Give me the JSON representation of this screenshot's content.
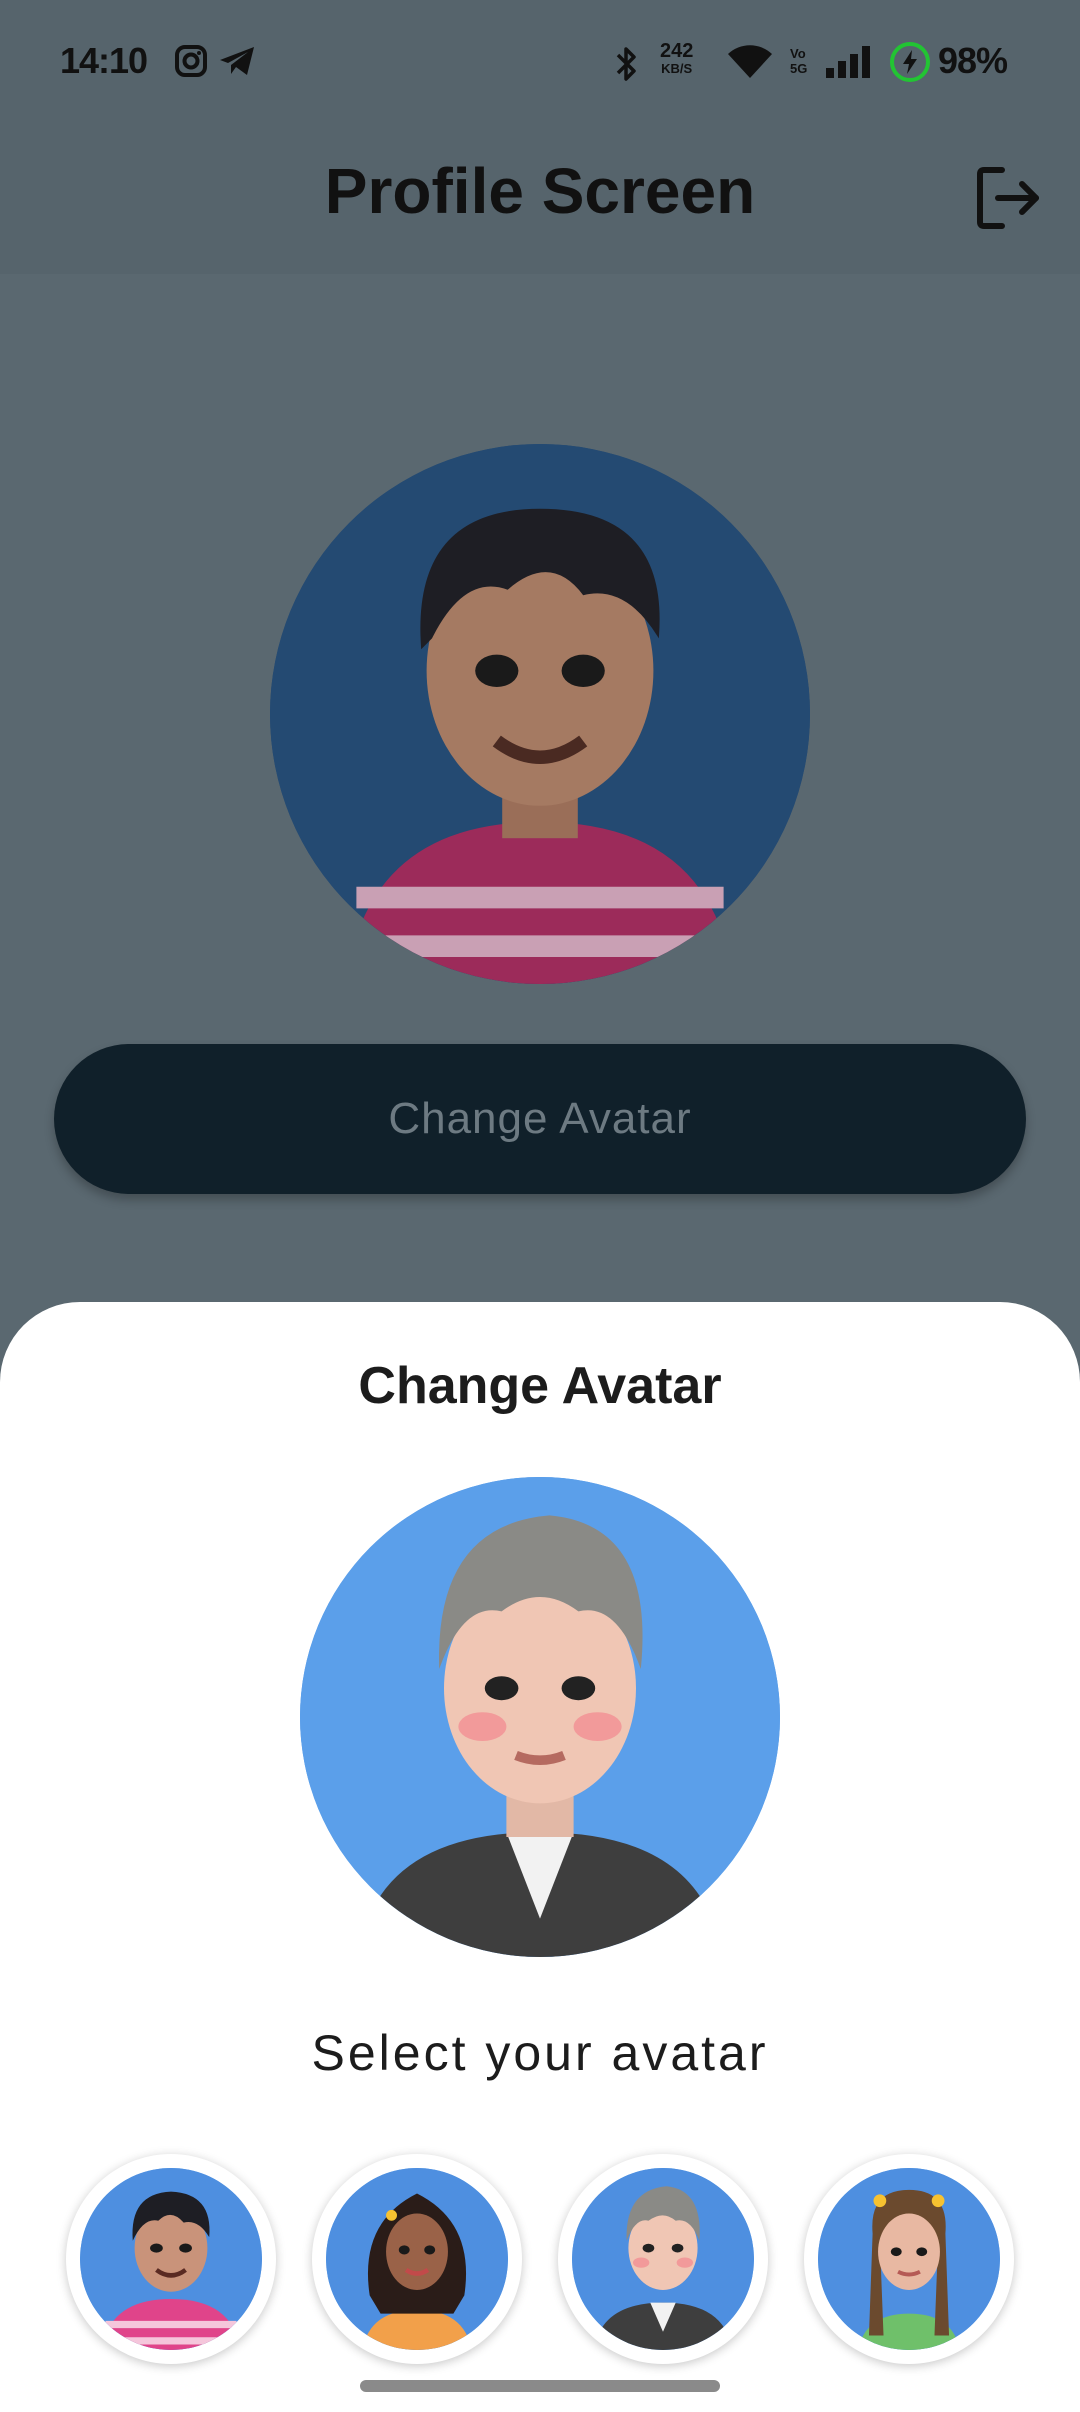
{
  "status_bar": {
    "time": "14:10",
    "net_speed_top": "242",
    "net_speed_bottom": "KB/S",
    "volte_top": "Vo",
    "volte_bottom": "5G",
    "battery": "98%",
    "icons": [
      "instagram-icon",
      "telegram-icon",
      "bluetooth-icon",
      "wifi-icon",
      "signal-icon",
      "battery-charging-icon"
    ]
  },
  "app_bar": {
    "title": "Profile Screen",
    "logout_icon": "logout-icon"
  },
  "profile": {
    "change_button_label": "Change Avatar"
  },
  "sheet": {
    "title": "Change Avatar",
    "select_label": "Select your avatar",
    "avatars": [
      {
        "name": "avatar-boy-striped-shirt"
      },
      {
        "name": "avatar-girl-curly-hair"
      },
      {
        "name": "avatar-gray-hair-suit"
      },
      {
        "name": "avatar-girl-braids"
      }
    ]
  },
  "colors": {
    "overlay": "#5a6870",
    "button": "#10202a",
    "avatar_bg": "#5b9fea",
    "sheet_bg": "#ffffff"
  }
}
